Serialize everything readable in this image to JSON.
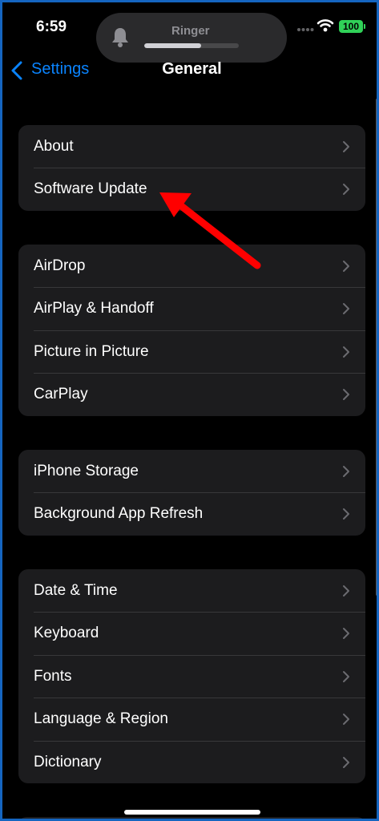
{
  "status_bar": {
    "time": "6:59",
    "battery": "100",
    "ringer": {
      "label": "Ringer",
      "volume_fraction": 0.6
    }
  },
  "nav": {
    "back_label": "Settings",
    "title": "General"
  },
  "groups": [
    {
      "items": [
        {
          "label": "About"
        },
        {
          "label": "Software Update"
        }
      ]
    },
    {
      "items": [
        {
          "label": "AirDrop"
        },
        {
          "label": "AirPlay & Handoff"
        },
        {
          "label": "Picture in Picture"
        },
        {
          "label": "CarPlay"
        }
      ]
    },
    {
      "items": [
        {
          "label": "iPhone Storage"
        },
        {
          "label": "Background App Refresh"
        }
      ]
    },
    {
      "items": [
        {
          "label": "Date & Time"
        },
        {
          "label": "Keyboard"
        },
        {
          "label": "Fonts"
        },
        {
          "label": "Language & Region"
        },
        {
          "label": "Dictionary"
        }
      ]
    }
  ],
  "annotation": {
    "color": "#ff0000",
    "points_to": "Software Update"
  },
  "colors": {
    "accent": "#0a84ff",
    "background": "#000000",
    "cell": "#1c1c1e",
    "battery": "#30d158",
    "frame_border": "#1565c0"
  },
  "icons": [
    "bell-icon",
    "wifi-icon",
    "cellular-dots-icon",
    "chevron-left-icon",
    "chevron-right-icon"
  ]
}
